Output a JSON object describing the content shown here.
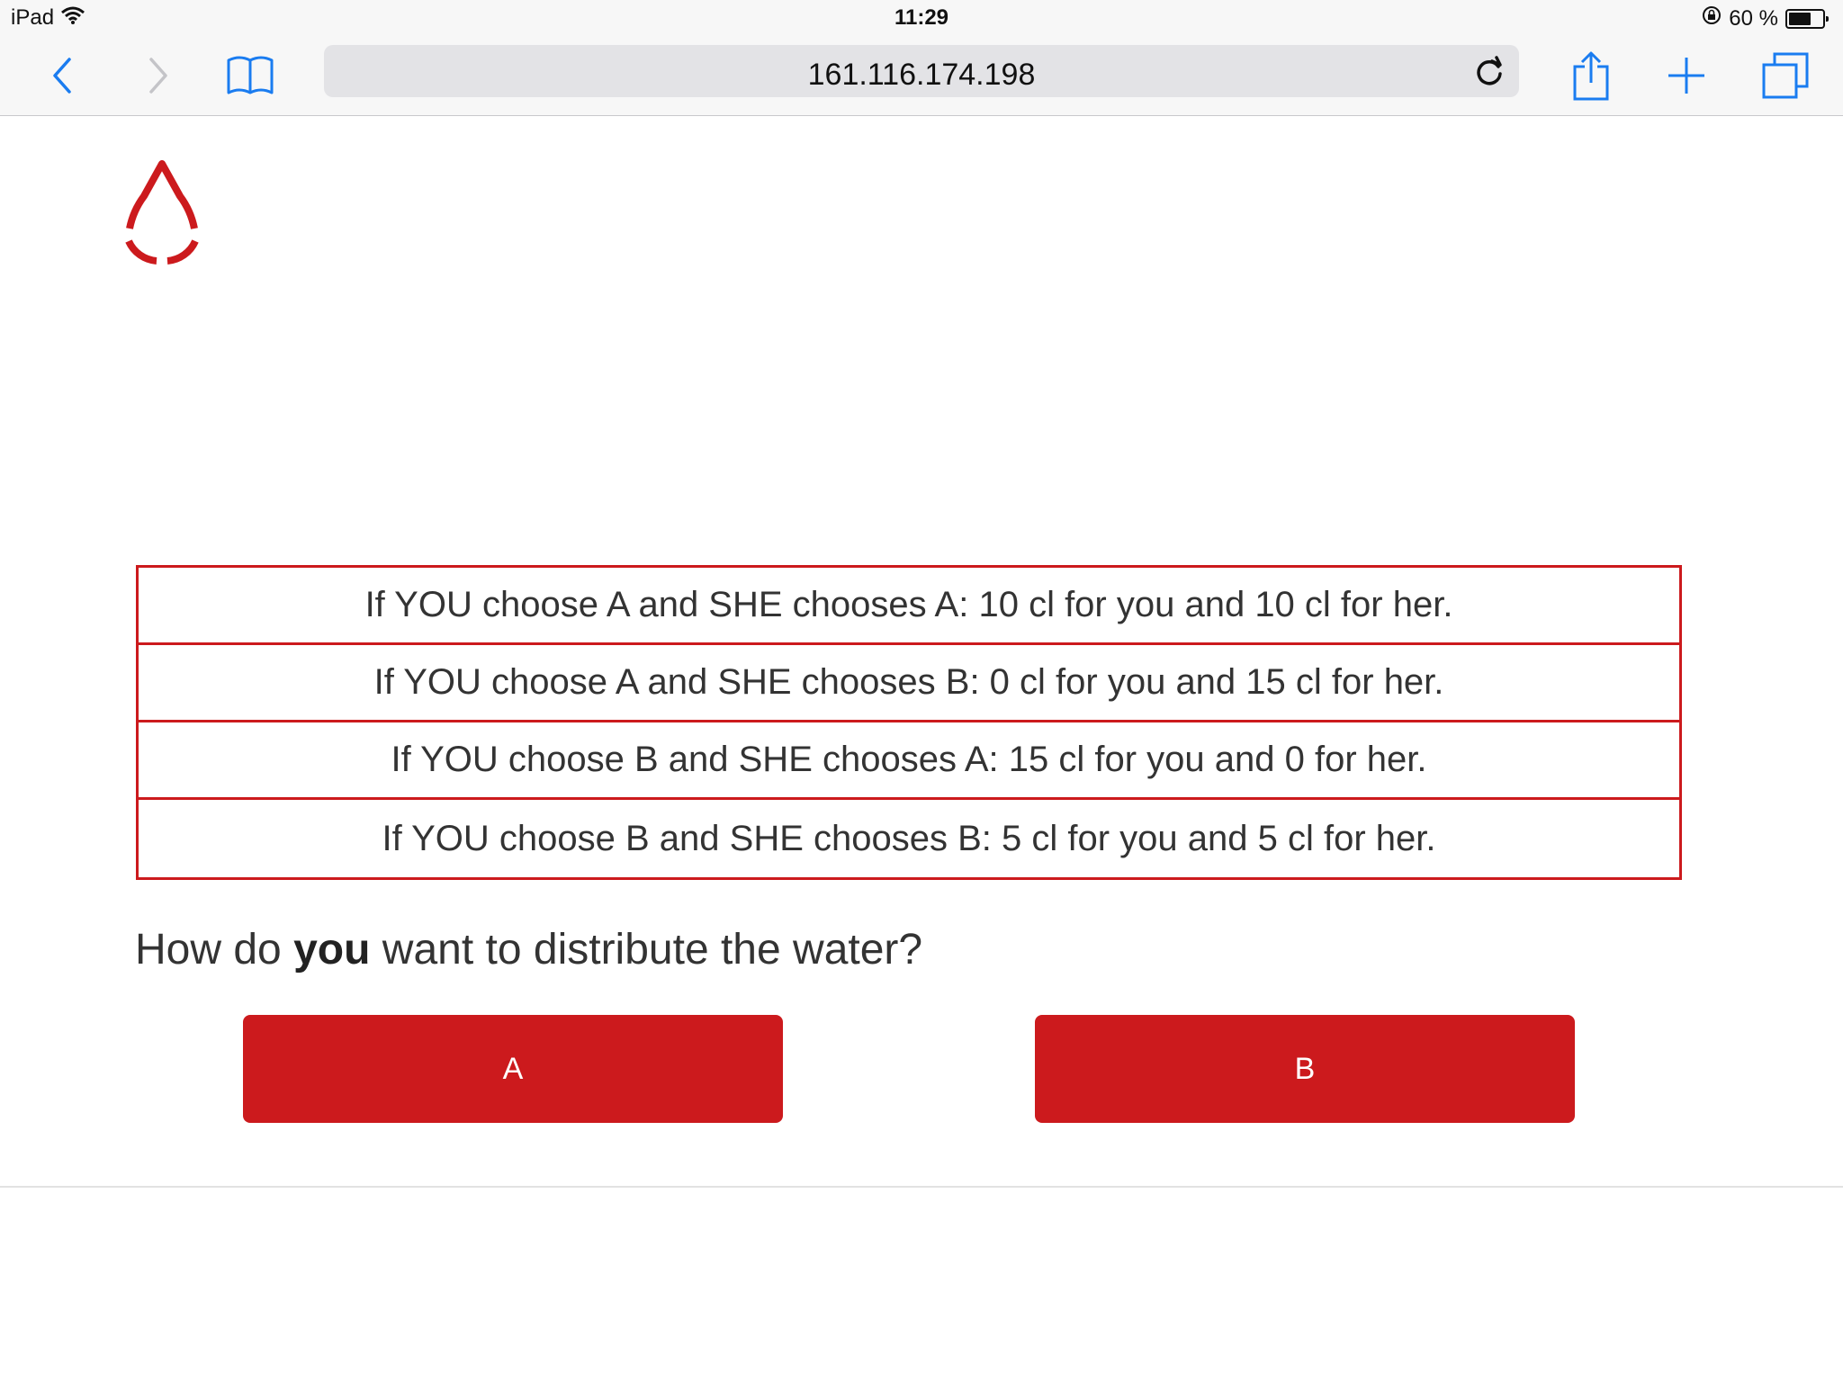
{
  "status_bar": {
    "device": "iPad",
    "time": "11:29",
    "battery_text": "60 %",
    "battery_level": 0.6
  },
  "toolbar": {
    "url": "161.116.174.198"
  },
  "payoff_table": {
    "rows": [
      "If YOU choose A and SHE chooses A: 10 cl for you and 10 cl for her.",
      "If YOU choose A and SHE chooses B: 0 cl for you and 15 cl for her.",
      "If YOU choose B and SHE chooses A: 15 cl for you and 0 for her.",
      "If YOU choose B and SHE chooses B: 5 cl for you and 5 cl for her."
    ]
  },
  "question": {
    "before": "How do ",
    "emphasis": "you",
    "after": " want to distribute the water?"
  },
  "choices": {
    "a_label": "A",
    "b_label": "B"
  },
  "colors": {
    "accent": "#cc1a1d",
    "ios_blue": "#1a7cf0"
  },
  "icons": [
    "wifi-icon",
    "orientation-lock-icon",
    "battery-icon",
    "back-icon",
    "forward-icon",
    "bookmarks-icon",
    "reload-icon",
    "share-icon",
    "add-tab-icon",
    "tabs-icon",
    "water-drop-logo"
  ]
}
